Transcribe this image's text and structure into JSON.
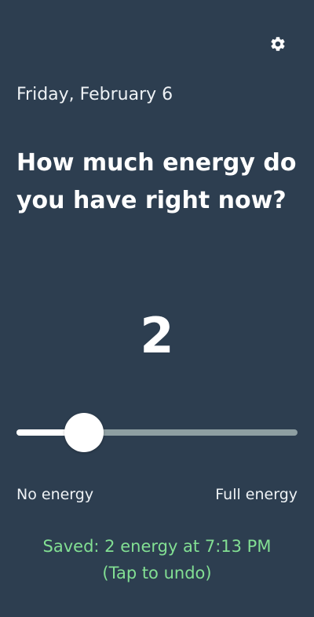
{
  "header": {
    "settings_icon": "gear-icon"
  },
  "date": "Friday, February 6",
  "question": "How much energy do you have right now?",
  "slider": {
    "value": 2,
    "min_label": "No energy",
    "max_label": "Full energy"
  },
  "saved": {
    "message": "Saved: 2 energy at 7:13 PM",
    "undo": "(Tap to undo)"
  },
  "colors": {
    "background": "#2d3e50",
    "accent_saved": "#82df93",
    "track": "#8e9fa2",
    "fill": "#ffffff"
  }
}
